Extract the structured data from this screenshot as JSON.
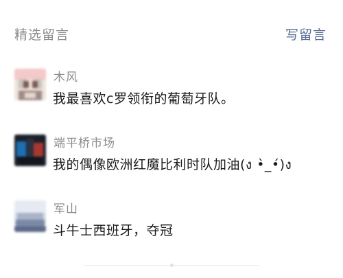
{
  "header": {
    "title": "精选留言",
    "write_label": "写留言"
  },
  "comments": [
    {
      "name": "木风",
      "text": "我最喜欢c罗领衔的葡萄牙队。"
    },
    {
      "name": "端平桥市场",
      "text": "我的偶像欧洲红魔比利时队加油(ง •̀_•́)ง"
    },
    {
      "name": "军山",
      "text": "斗牛士西班牙，夺冠"
    }
  ],
  "colors": {
    "link": "#576b95",
    "muted": "#8c8c8c",
    "text": "#1a1a1a"
  }
}
